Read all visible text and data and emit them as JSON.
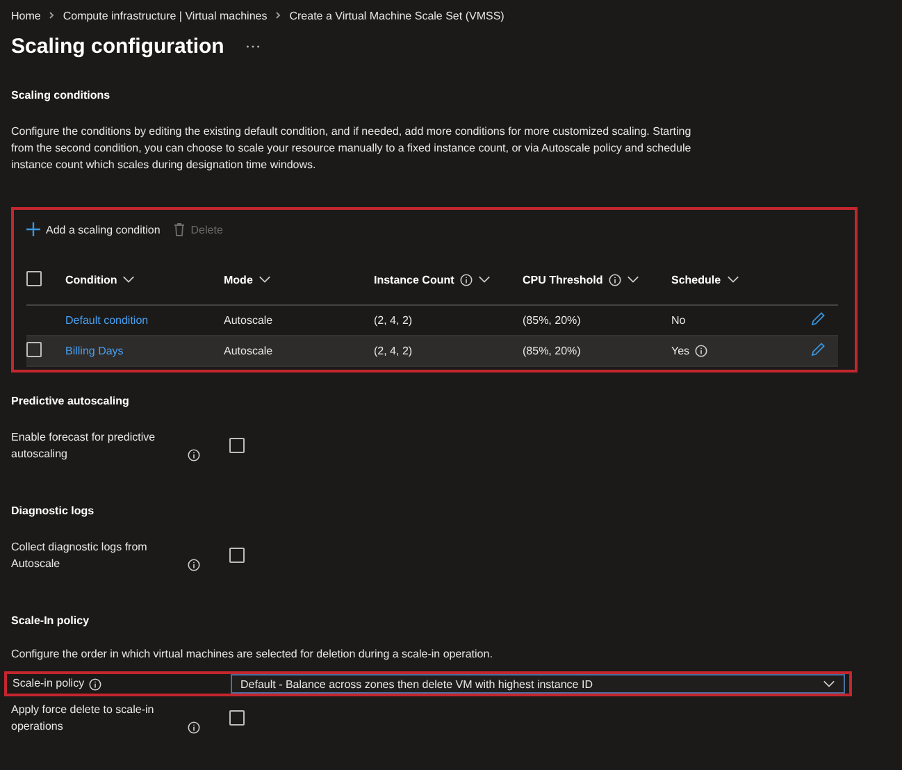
{
  "breadcrumb": [
    "Home",
    "Compute infrastructure | Virtual machines",
    "Create a Virtual Machine Scale Set (VMSS)"
  ],
  "title": "Scaling configuration",
  "scaling_conditions": {
    "heading": "Scaling conditions",
    "description": "Configure the conditions by editing the existing default condition, and if needed, add more conditions for more customized scaling. Starting from the second condition, you can choose to scale your resource manually to a fixed instance count, or via Autoscale policy and schedule instance count which scales during designation time windows.",
    "highlighted": true,
    "toolbar": [
      {
        "kind": "add",
        "label": "Add a scaling condition",
        "disabled": false
      },
      {
        "kind": "delete",
        "label": "Delete",
        "disabled": true
      }
    ],
    "select_all": {
      "checked": false
    },
    "columns": [
      {
        "label": "Condition",
        "info": false
      },
      {
        "label": "Mode",
        "info": false
      },
      {
        "label": "Instance Count",
        "info": true
      },
      {
        "label": "CPU Threshold",
        "info": true
      },
      {
        "label": "Schedule",
        "info": false
      }
    ],
    "rows": [
      {
        "condition": "Default condition",
        "mode": "Autoscale",
        "instance_count": "(2, 4, 2)",
        "cpu_threshold": "(85%, 20%)",
        "schedule": "No",
        "schedule_info": false,
        "selectable": false,
        "highlighted": false
      },
      {
        "condition": "Billing Days",
        "mode": "Autoscale",
        "instance_count": "(2, 4, 2)",
        "cpu_threshold": "(85%, 20%)",
        "schedule": "Yes",
        "schedule_info": true,
        "selectable": true,
        "checked": false,
        "highlighted": true
      }
    ]
  },
  "predictive_autoscaling": {
    "heading": "Predictive autoscaling",
    "fields": [
      {
        "label": "Enable forecast for predictive autoscaling",
        "info": true,
        "checked": false
      }
    ]
  },
  "diagnostic_logs": {
    "heading": "Diagnostic logs",
    "fields": [
      {
        "label": "Collect diagnostic logs from Autoscale",
        "info": true,
        "checked": false
      }
    ]
  },
  "scale_in_policy": {
    "heading": "Scale-In policy",
    "description": "Configure the order in which virtual machines are selected for deletion during a scale-in operation.",
    "policy": {
      "label": "Scale-in policy",
      "info": true,
      "value": "Default - Balance across zones then delete VM with highest instance ID",
      "highlighted": true
    },
    "fields": [
      {
        "label": "Apply force delete to scale-in operations",
        "info": true,
        "checked": false
      }
    ]
  }
}
